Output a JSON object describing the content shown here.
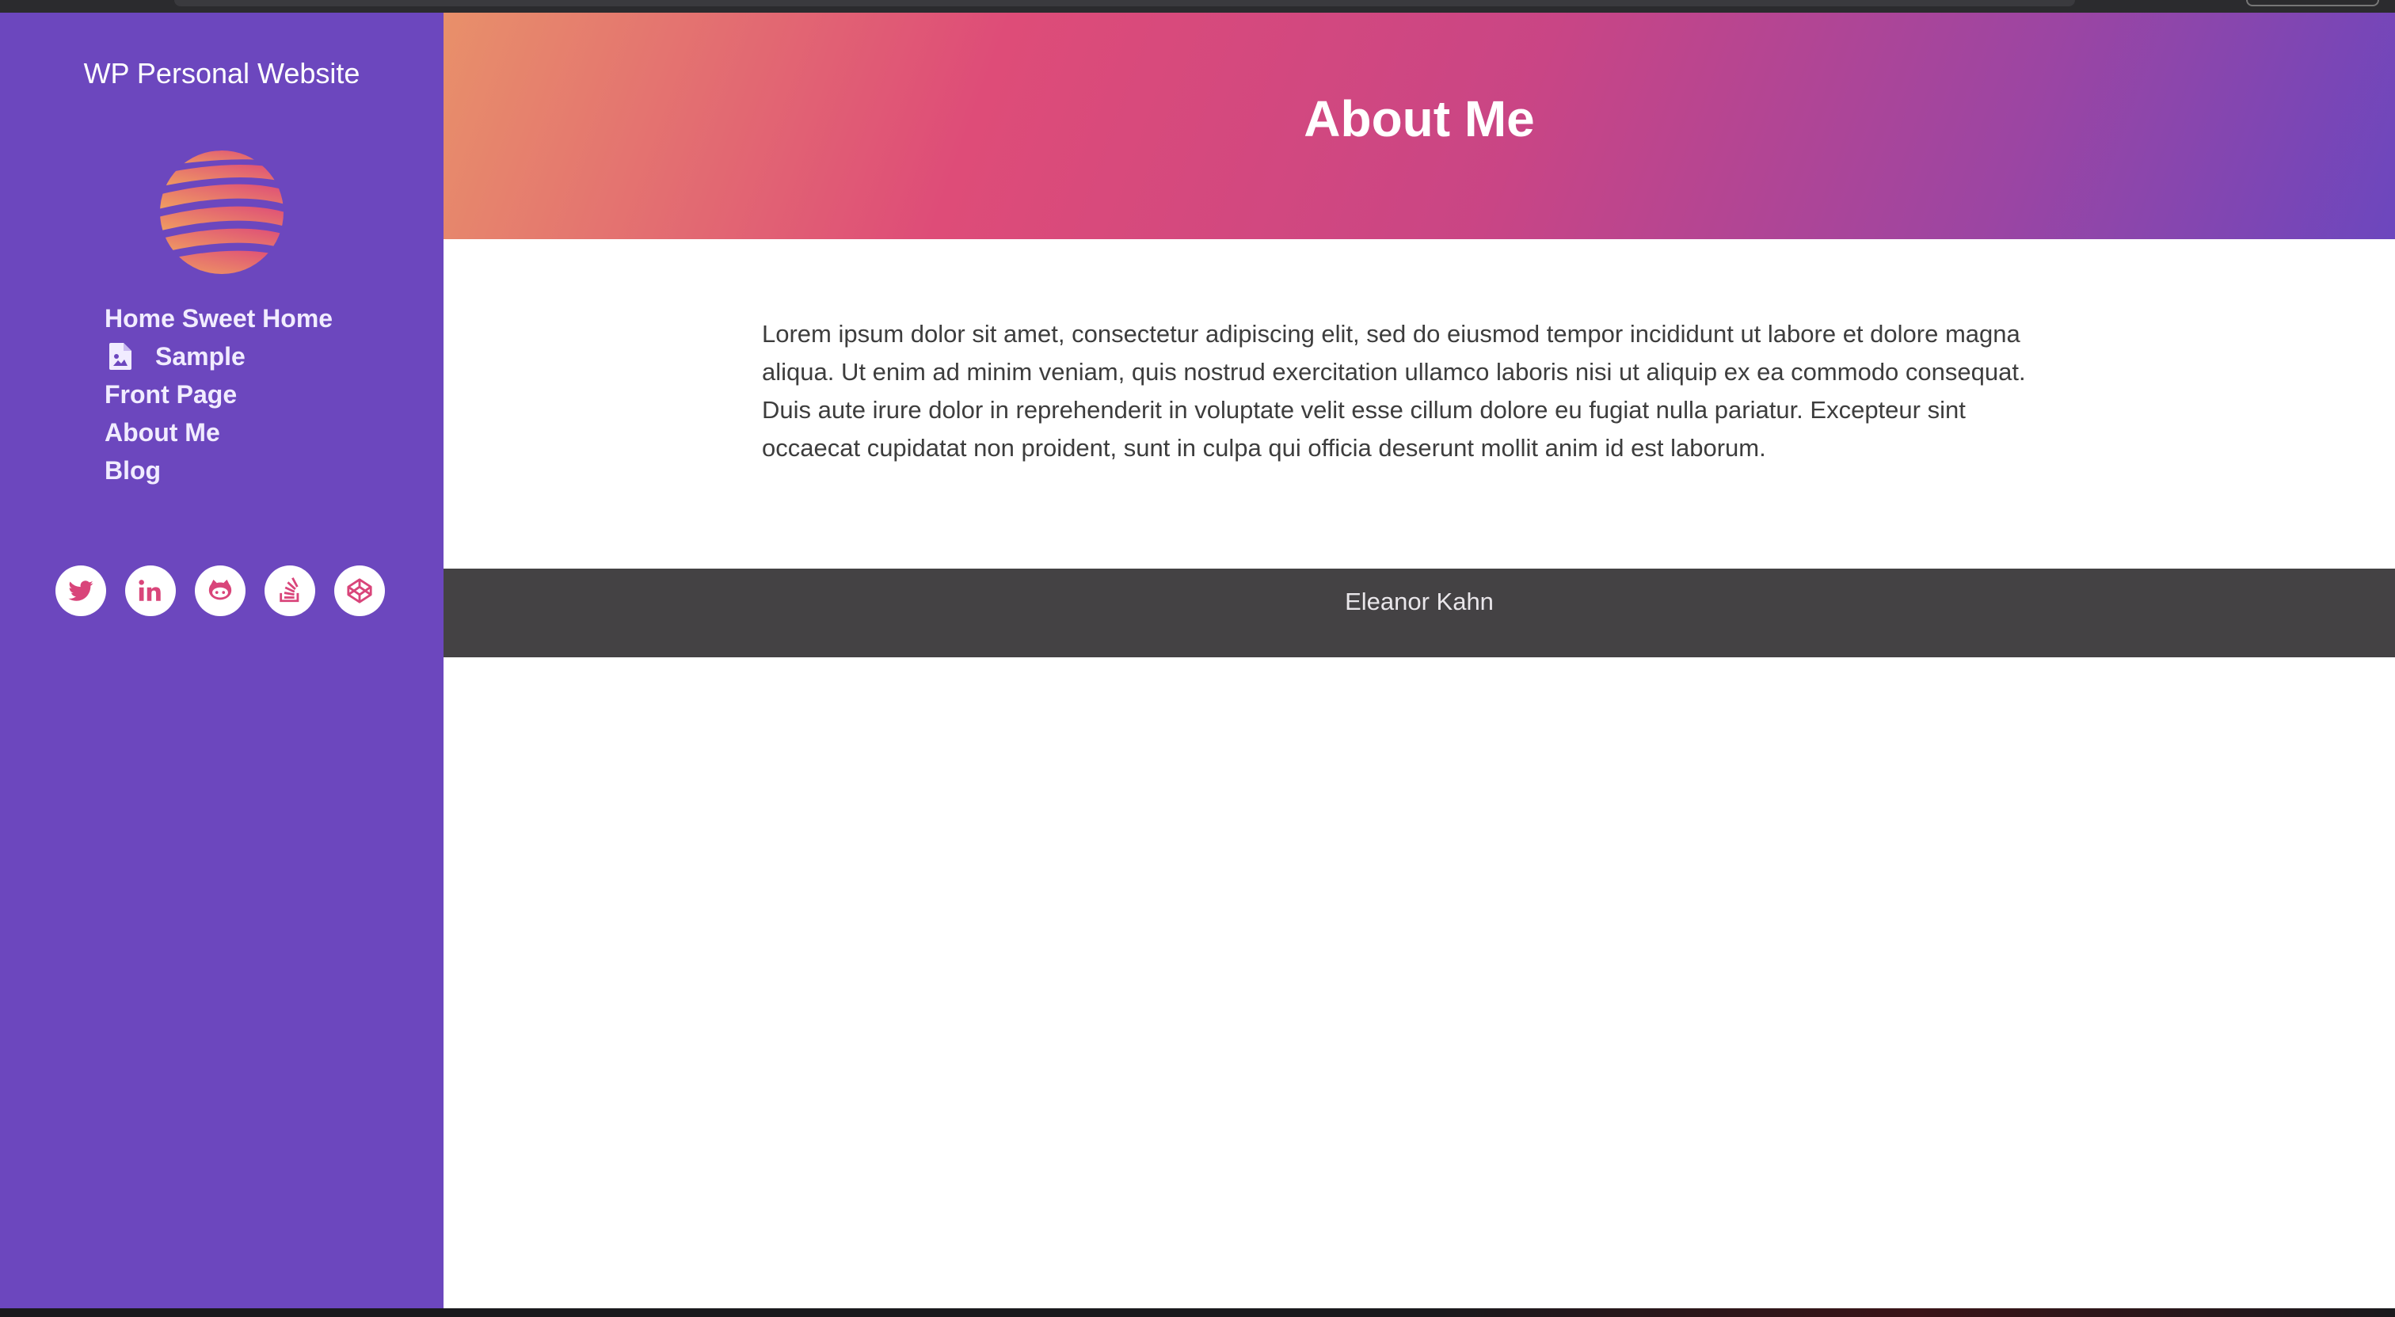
{
  "site": {
    "title": "WP Personal Website"
  },
  "nav": {
    "items": [
      {
        "label": "Home Sweet Home"
      },
      {
        "label": "Sample",
        "icon": "document-icon"
      },
      {
        "label": "Front Page"
      },
      {
        "label": "About Me"
      },
      {
        "label": "Blog"
      }
    ]
  },
  "socials": [
    {
      "name": "twitter",
      "icon": "twitter-icon"
    },
    {
      "name": "linkedin",
      "icon": "linkedin-icon"
    },
    {
      "name": "github",
      "icon": "github-icon"
    },
    {
      "name": "stackoverflow",
      "icon": "stackoverflow-icon"
    },
    {
      "name": "codepen",
      "icon": "codepen-icon"
    }
  ],
  "page": {
    "title": "About Me",
    "body": "Lorem ipsum dolor sit amet, consectetur adipiscing elit, sed do eiusmod tempor incididunt ut labore et dolore magna aliqua. Ut enim ad minim veniam, quis nostrud exercitation ullamco laboris nisi ut aliquip ex ea commodo consequat. Duis aute irure dolor in reprehenderit in voluptate velit esse cillum dolore eu fugiat nulla pariatur. Excepteur sint occaecat cupidatat non proident, sunt in culpa qui officia deserunt mollit anim id est laborum."
  },
  "footer": {
    "text": "Eleanor Kahn"
  },
  "colors": {
    "sidebar": "#6c47be",
    "accent": "#de4c78",
    "footer": "#444244"
  }
}
